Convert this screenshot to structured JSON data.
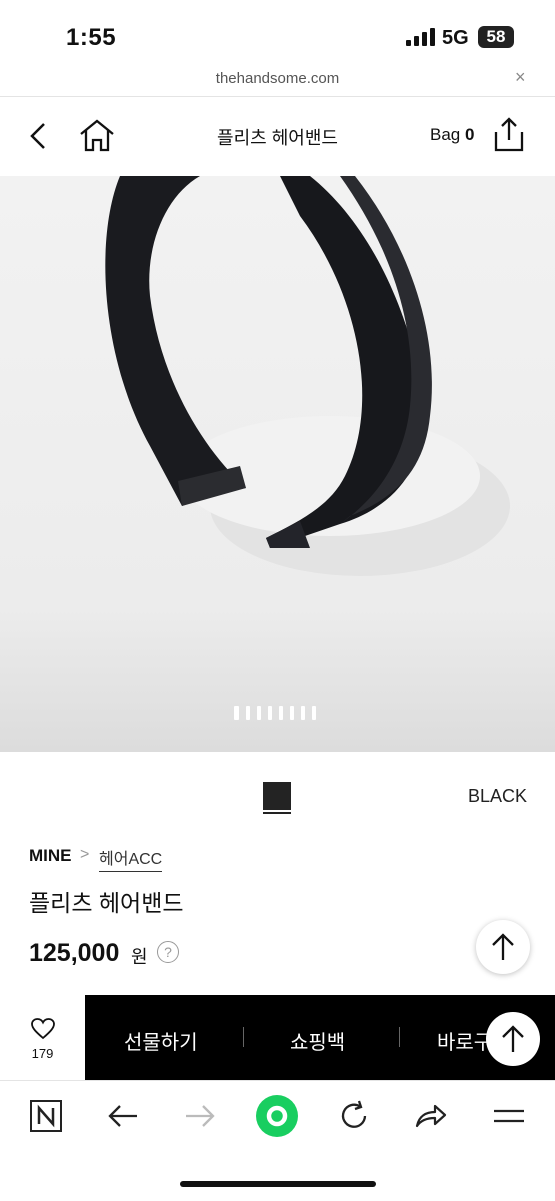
{
  "status": {
    "time": "1:55",
    "network": "5G",
    "battery": "58"
  },
  "browser": {
    "url": "thehandsome.com",
    "close_glyph": "×"
  },
  "nav": {
    "title": "플리츠 헤어밴드",
    "bag_label": "Bag",
    "bag_count": "0"
  },
  "gallery": {
    "image_count": 8,
    "current_index": 0
  },
  "color": {
    "name": "BLACK",
    "swatch": "#232323"
  },
  "product": {
    "brand": "MINE",
    "breadcrumb_sep": ">",
    "category": "헤어ACC",
    "name": "플리츠 헤어밴드",
    "price": "125,000",
    "currency": "원",
    "help": "?"
  },
  "actions": {
    "like_count": "179",
    "gift_label": "선물하기",
    "cart_label": "쇼핑백",
    "buy_label": "바로구"
  },
  "icons": {
    "back": "chevron-left-icon",
    "home": "home-icon",
    "share": "share-icon",
    "heart": "heart-icon",
    "scroll_top": "arrow-up-icon",
    "naver": "naver-n-icon",
    "browser_back": "arrow-left-icon",
    "browser_forward": "arrow-right-icon",
    "green": "green-dot-button",
    "reload": "reload-icon",
    "forward_share": "share-arrow-icon",
    "menu": "menu-icon"
  },
  "colors": {
    "accent_green": "#19ce60",
    "action_bar": "#000000"
  }
}
